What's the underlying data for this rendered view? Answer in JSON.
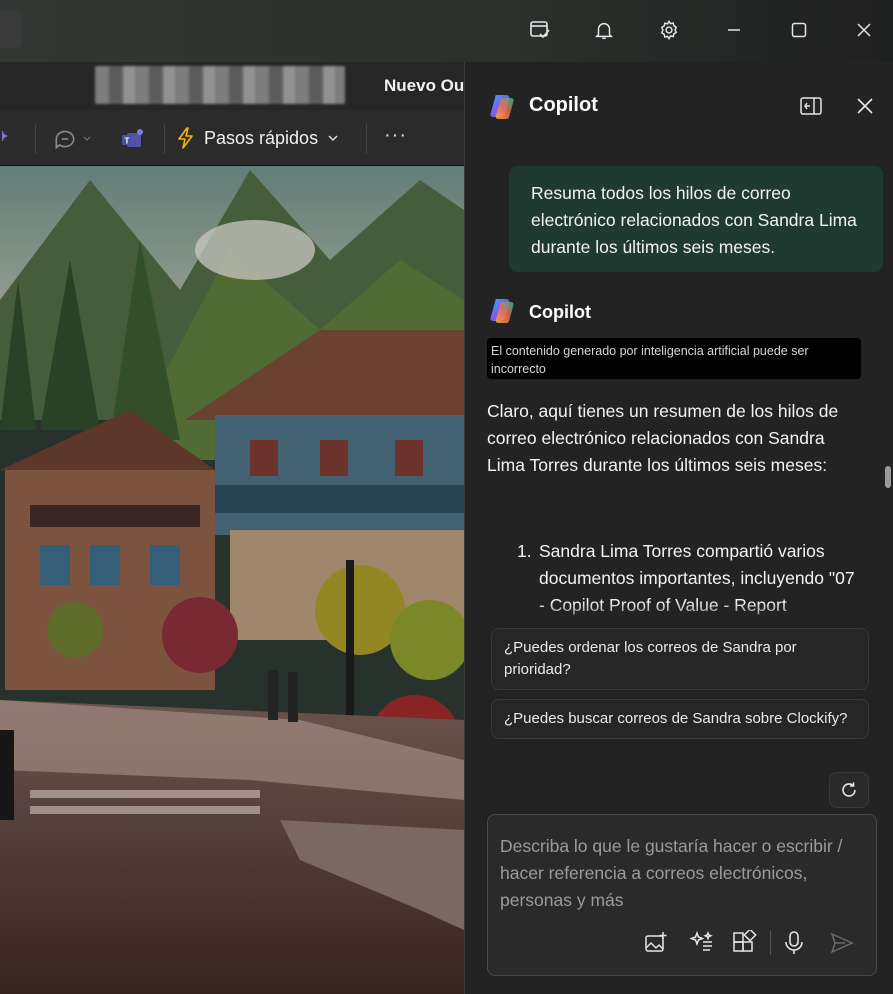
{
  "outlook": {
    "ribbon_title": "Nuevo Ou",
    "quick_steps_label": "Pasos rápidos",
    "more_label": "···"
  },
  "copilot": {
    "title": "Copilot",
    "user_prompt": "Resuma todos los hilos de correo electrónico relacionados con Sandra Lima durante los últimos seis meses.",
    "bot_name": "Copilot",
    "disclaimer": "El contenido generado por inteligencia artificial puede ser incorrecto",
    "response_intro": "Claro, aquí tienes un resumen de los hilos de correo electrónico relacionados con Sandra Lima Torres durante los últimos seis meses:",
    "response_items": [
      {
        "num": "1.",
        "text": "Sandra Lima Torres compartió varios documentos importantes, incluyendo \"07 - Copilot Proof of Value - Report"
      }
    ],
    "suggestions": [
      {
        "label": "¿Puedes ordenar los correos de Sandra por prioridad?"
      },
      {
        "label": "¿Puedes buscar correos de Sandra sobre Clockify?"
      }
    ],
    "composer_placeholder": "Describa lo que le gustaría hacer o escribir / hacer referencia a correos electrónicos, personas y más"
  },
  "icons": {
    "titlebar": [
      "whats-new-icon",
      "bell-icon",
      "gear-icon",
      "minimize-icon",
      "maximize-icon",
      "close-icon"
    ],
    "composer": [
      "image-add-icon",
      "sparkle-prompt-icon",
      "apps-icon",
      "microphone-icon",
      "send-icon"
    ]
  },
  "colors": {
    "user_bubble": "#1e3a31",
    "panel_bg": "#232323",
    "quick_steps_bolt": "#f5b800"
  }
}
